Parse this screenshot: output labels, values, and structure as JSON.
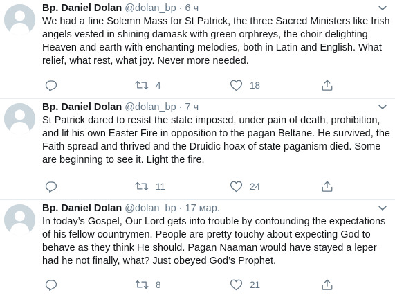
{
  "tweets": [
    {
      "author": "Bp. Daniel Dolan",
      "handle": "@dolan_bp",
      "separator": "·",
      "time": "6 ч",
      "text": "We had a fine Solemn Mass for St Patrick, the three Sacred Ministers like Irish angels vested in shining damask with green orphreys, the choir delighting Heaven and earth with enchanting melodies, both in Latin and English. What relief, what rest, what joy. Never more needed.",
      "reply_count": "",
      "retweet_count": "4",
      "like_count": "18"
    },
    {
      "author": "Bp. Daniel Dolan",
      "handle": "@dolan_bp",
      "separator": "·",
      "time": "7 ч",
      "text": "St Patrick dared to resist the state imposed, under pain of death, prohibition, and lit his own Easter Fire in opposition to the pagan Beltane. He survived, the Faith spread and thrived and the Druidic hoax of state paganism died. Some are beginning to see it. Light the fire.",
      "reply_count": "",
      "retweet_count": "11",
      "like_count": "24"
    },
    {
      "author": "Bp. Daniel Dolan",
      "handle": "@dolan_bp",
      "separator": "·",
      "time": "17 мар.",
      "text": "In today’s Gospel, Our Lord gets into trouble by confounding the expectations of his fellow countrymen. People are pretty touchy about expecting God to behave as they think He should. Pagan Naaman would have stayed a leper had he not finally, what? Just obeyed God’s Prophet.",
      "reply_count": "",
      "retweet_count": "8",
      "like_count": "21"
    }
  ],
  "icons": {
    "reply": "reply-icon",
    "retweet": "retweet-icon",
    "like": "heart-icon",
    "share": "share-icon",
    "caret": "chevron-down-icon",
    "avatar": "default-avatar-icon"
  },
  "colors": {
    "text": "#14171a",
    "secondary": "#657786",
    "divider": "#e6ecf0",
    "avatar_bg": "#ccd6dd",
    "avatar_fg": "#ffffff"
  }
}
